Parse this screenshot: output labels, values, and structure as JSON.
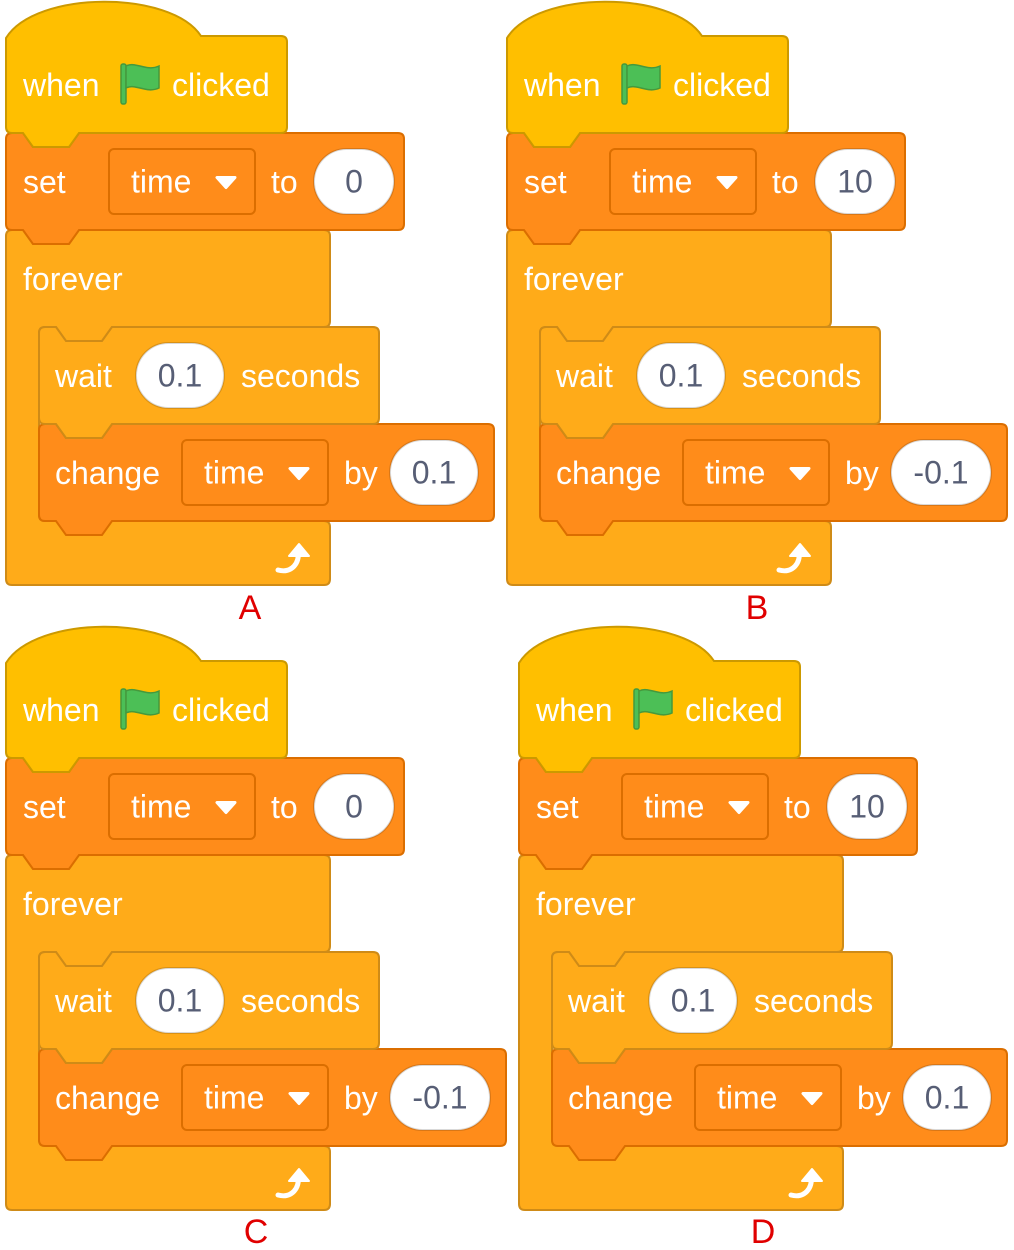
{
  "colors": {
    "events": "#FFBF00",
    "events_border": "#CC9900",
    "variables": "#FF8C1A",
    "variables_border": "#DB6E00",
    "control": "#FFAB19",
    "control_border": "#CF8B17",
    "label": "#E00000",
    "flag": "#4CBF56",
    "flag_border": "#45993D"
  },
  "icons": {
    "flag": "green-flag-icon",
    "dropdown": "dropdown-arrow-icon",
    "loop": "loop-arrow-icon"
  },
  "options": [
    {
      "label": "A",
      "hat": {
        "when": "when",
        "clicked": "clicked"
      },
      "set": {
        "word": "set",
        "variable": "time",
        "to": "to",
        "value": "0"
      },
      "forever": "forever",
      "wait": {
        "word": "wait",
        "value": "0.1",
        "unit": "seconds"
      },
      "change": {
        "word": "change",
        "variable": "time",
        "by": "by",
        "value": "0.1"
      }
    },
    {
      "label": "B",
      "hat": {
        "when": "when",
        "clicked": "clicked"
      },
      "set": {
        "word": "set",
        "variable": "time",
        "to": "to",
        "value": "10"
      },
      "forever": "forever",
      "wait": {
        "word": "wait",
        "value": "0.1",
        "unit": "seconds"
      },
      "change": {
        "word": "change",
        "variable": "time",
        "by": "by",
        "value": "-0.1"
      }
    },
    {
      "label": "C",
      "hat": {
        "when": "when",
        "clicked": "clicked"
      },
      "set": {
        "word": "set",
        "variable": "time",
        "to": "to",
        "value": "0"
      },
      "forever": "forever",
      "wait": {
        "word": "wait",
        "value": "0.1",
        "unit": "seconds"
      },
      "change": {
        "word": "change",
        "variable": "time",
        "by": "by",
        "value": "-0.1"
      }
    },
    {
      "label": "D",
      "hat": {
        "when": "when",
        "clicked": "clicked"
      },
      "set": {
        "word": "set",
        "variable": "time",
        "to": "to",
        "value": "10"
      },
      "forever": "forever",
      "wait": {
        "word": "wait",
        "value": "0.1",
        "unit": "seconds"
      },
      "change": {
        "word": "change",
        "variable": "time",
        "by": "by",
        "value": "0.1"
      }
    }
  ]
}
